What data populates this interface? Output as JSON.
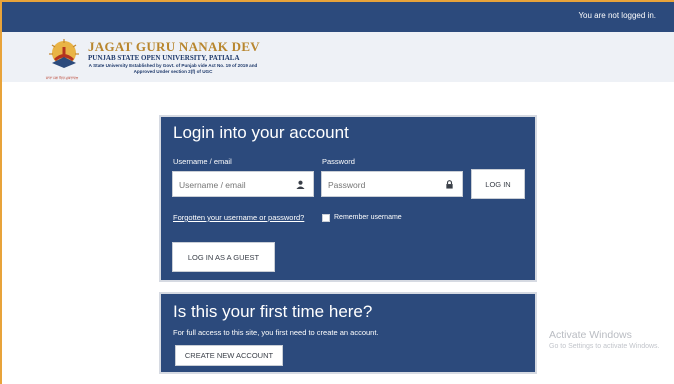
{
  "topbar": {
    "login_status": "You are not logged in."
  },
  "brand": {
    "title": "JAGAT GURU NANAK DEV",
    "subtitle": "PUNJAB STATE OPEN UNIVERSITY, PATIALA",
    "description": "A State University Established by Govt. of Punjab vide Act No. 19 of 2019 and Approved Under section 2(f) of UGC",
    "logo_caption": "ਸਾਰਾ ਜਗ ਵਿਚ ਮੁਕਤਾਵਲ"
  },
  "login": {
    "title": "Login into your account",
    "username_label": "Username / email",
    "username_placeholder": "Username / email",
    "password_label": "Password",
    "password_placeholder": "Password",
    "login_button": "LOG IN",
    "forgot_link": "Forgotten your username or password?",
    "remember_label": "Remember username",
    "guest_button": "LOG IN AS A GUEST"
  },
  "first_time": {
    "title": "Is this your first time here?",
    "text": "For full access to this site, you first need to create an account.",
    "create_button": "CREATE NEW ACCOUNT"
  },
  "watermark": {
    "line1": "Activate Windows",
    "line2": "Go to Settings to activate Windows."
  },
  "colors": {
    "navy": "#2c4a7c",
    "brand_gold": "#b8862e",
    "page_bg": "#ffffff",
    "frame_accent": "#e8a33a"
  },
  "icons": {
    "username_icon": "user-icon",
    "password_icon": "lock-icon",
    "logo": "university-logo"
  }
}
